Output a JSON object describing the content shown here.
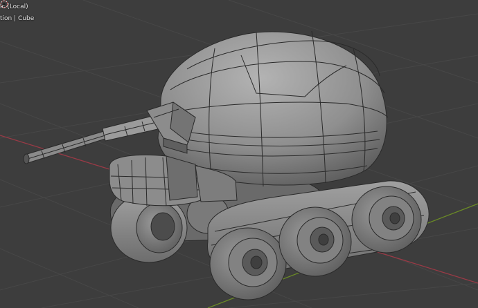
{
  "viewport": {
    "view_name": "ic (Local)",
    "collection": "tion",
    "separator": "|",
    "active_object": "Cube"
  },
  "colors": {
    "background": "#3d3d3d",
    "grid": "#474747",
    "x_axis": "#9a3a46",
    "y_axis": "#6a8a26",
    "mesh_fill": "#8e8e8e",
    "mesh_shade": "#5a5a5a",
    "wireframe": "#2a2a2a",
    "cursor_red": "#d04040"
  },
  "icons": {
    "cursor": "3d-cursor-icon"
  }
}
